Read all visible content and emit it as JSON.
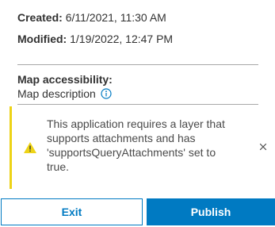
{
  "item_details": {
    "created_label": "Created:",
    "created_value": "6/11/2021, 11:30 AM",
    "modified_label": "Modified:",
    "modified_value": "1/19/2022, 12:47 PM"
  },
  "accessibility": {
    "heading": "Map accessibility:",
    "description_label": "Map description",
    "info_icon": "info-circle-icon"
  },
  "notice": {
    "icon": "warning-triangle-icon",
    "message": "This application requires a layer that supports attachments and has 'supportsQueryAttachments' set to true.",
    "close_icon": "close-icon",
    "accent_color": "#edd317"
  },
  "actions": {
    "exit_label": "Exit",
    "publish_label": "Publish",
    "brand_color": "#007ac2"
  }
}
